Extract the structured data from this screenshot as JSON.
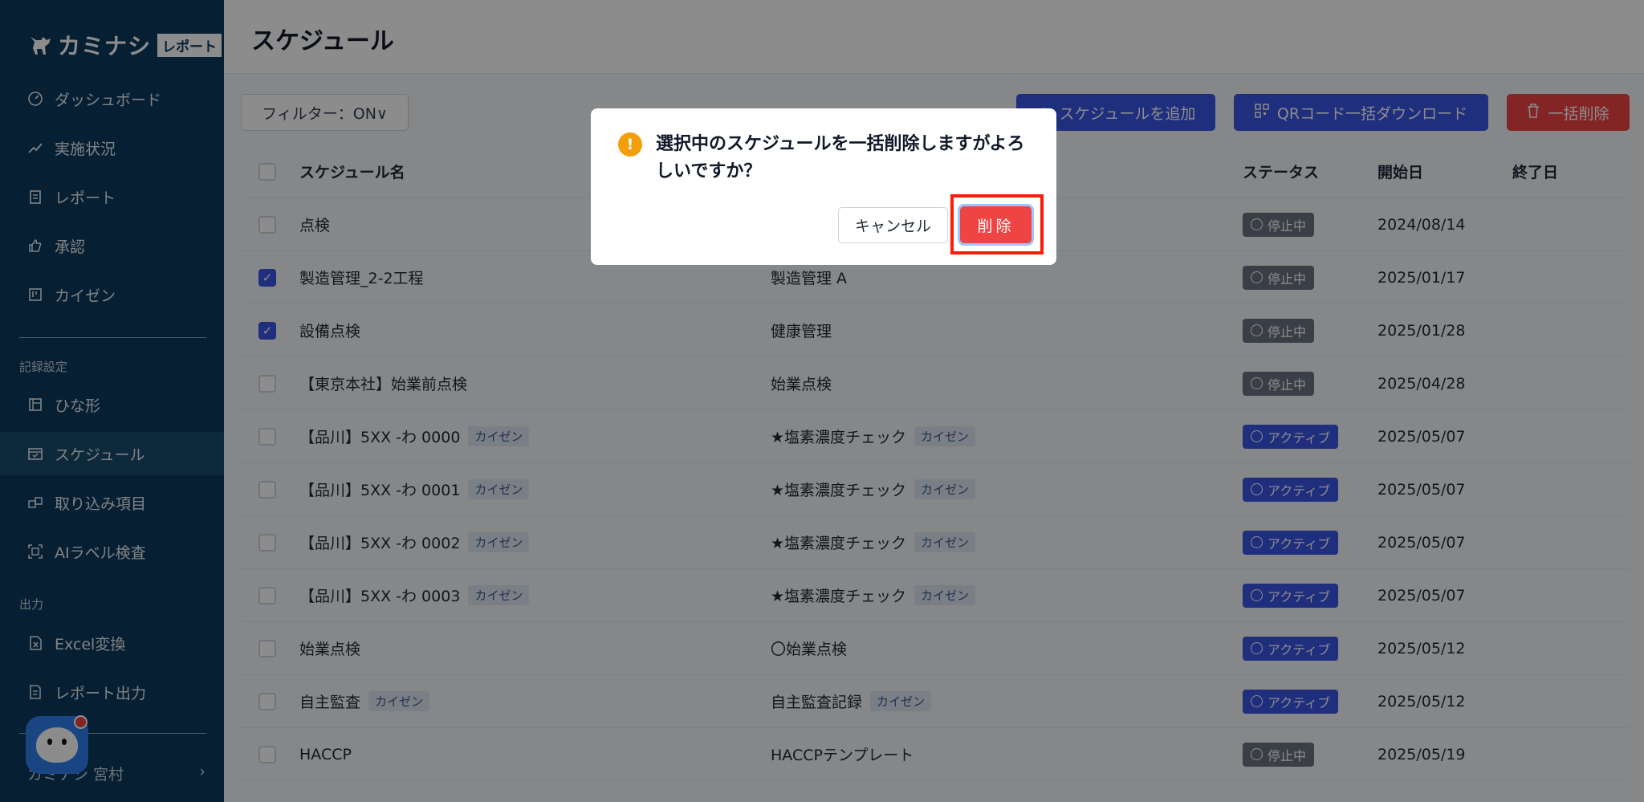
{
  "app": {
    "logo_text": "カミナシ",
    "logo_badge": "レポート"
  },
  "sidebar": {
    "items": [
      {
        "label": "ダッシュボード",
        "icon": "gauge-icon"
      },
      {
        "label": "実施状況",
        "icon": "trend-icon"
      },
      {
        "label": "レポート",
        "icon": "report-icon"
      },
      {
        "label": "承認",
        "icon": "thumbs-up-icon"
      },
      {
        "label": "カイゼン",
        "icon": "kanban-icon"
      }
    ],
    "section_records": "記録設定",
    "record_items": [
      {
        "label": "ひな形",
        "icon": "template-icon"
      },
      {
        "label": "スケジュール",
        "icon": "calendar-icon",
        "active": true
      },
      {
        "label": "取り込み項目",
        "icon": "import-icon"
      },
      {
        "label": "AIラベル検査",
        "icon": "ai-scan-icon"
      }
    ],
    "section_output": "出力",
    "output_items": [
      {
        "label": "Excel変換",
        "icon": "excel-icon"
      },
      {
        "label": "レポート出力",
        "icon": "export-icon"
      }
    ],
    "user_name": "カミナシ 宮村"
  },
  "header": {
    "title": "スケジュール"
  },
  "toolbar": {
    "filter_label": "フィルター：ON∨",
    "add_label": "スケジュールを追加",
    "qr_label": "QRコード一括ダウンロード",
    "bulk_delete_label": "一括削除"
  },
  "table": {
    "columns": [
      "スケジュール名",
      "ステータス",
      "開始日",
      "終了日"
    ],
    "rows": [
      {
        "name": "点検",
        "name_tag": "",
        "template": "",
        "template_tag": "",
        "status": "停止中",
        "start": "2024/08/14",
        "checked": false
      },
      {
        "name": "製造管理_2-2工程",
        "name_tag": "",
        "template": "製造管理 A",
        "template_tag": "",
        "status": "停止中",
        "start": "2025/01/17",
        "checked": true
      },
      {
        "name": "設備点検",
        "name_tag": "",
        "template": "健康管理",
        "template_tag": "",
        "status": "停止中",
        "start": "2025/01/28",
        "checked": true
      },
      {
        "name": "【東京本社】始業前点検",
        "name_tag": "",
        "template": "始業点検",
        "template_tag": "",
        "status": "停止中",
        "start": "2025/04/28",
        "checked": false
      },
      {
        "name": "【品川】5XX -わ 0000",
        "name_tag": "カイゼン",
        "template": "★塩素濃度チェック",
        "template_tag": "カイゼン",
        "status": "アクティブ",
        "start": "2025/05/07",
        "checked": false
      },
      {
        "name": "【品川】5XX -わ 0001",
        "name_tag": "カイゼン",
        "template": "★塩素濃度チェック",
        "template_tag": "カイゼン",
        "status": "アクティブ",
        "start": "2025/05/07",
        "checked": false
      },
      {
        "name": "【品川】5XX -わ 0002",
        "name_tag": "カイゼン",
        "template": "★塩素濃度チェック",
        "template_tag": "カイゼン",
        "status": "アクティブ",
        "start": "2025/05/07",
        "checked": false
      },
      {
        "name": "【品川】5XX -わ 0003",
        "name_tag": "カイゼン",
        "template": "★塩素濃度チェック",
        "template_tag": "カイゼン",
        "status": "アクティブ",
        "start": "2025/05/07",
        "checked": false
      },
      {
        "name": "始業点検",
        "name_tag": "",
        "template": "〇始業点検",
        "template_tag": "",
        "status": "アクティブ",
        "start": "2025/05/12",
        "checked": false
      },
      {
        "name": "自主監査",
        "name_tag": "カイゼン",
        "template": "自主監査記録",
        "template_tag": "カイゼン",
        "status": "アクティブ",
        "start": "2025/05/12",
        "checked": false
      },
      {
        "name": "HACCP",
        "name_tag": "",
        "template": "HACCPテンプレート",
        "template_tag": "",
        "status": "停止中",
        "start": "2025/05/19",
        "checked": false
      }
    ]
  },
  "modal": {
    "icon_glyph": "!",
    "message": "選択中のスケジュールを一括削除しますがよろしいですか？",
    "cancel_label": "キャンセル",
    "delete_label": "削除"
  },
  "colors": {
    "sidebar_bg": "#0b3a5c",
    "primary": "#3b55e6",
    "danger": "#ef4444",
    "highlight": "#ff1a0a"
  }
}
